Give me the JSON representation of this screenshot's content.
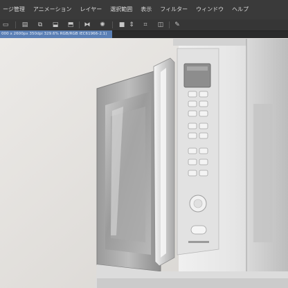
{
  "menubar": {
    "items": [
      "ージ管理",
      "アニメーション",
      "レイヤー",
      "選択範囲",
      "表示",
      "フィルター",
      "ウィンドウ",
      "ヘルプ"
    ]
  },
  "toolbar": {
    "icons": [
      "page-icon",
      "image-icon",
      "layer-icon",
      "save-icon",
      "flip-icon",
      "settings-icon",
      "color-icon",
      "transform-icon",
      "crop-icon",
      "pen-icon"
    ]
  },
  "document": {
    "info": "000 x 2600px 350dpi 329.6%  RGB/RGB IEC61966-2.1)"
  },
  "colors": {
    "menubar_bg": "#3a3a3a",
    "tab_bg": "#5a7fb5",
    "canvas_bg": "#e5e3e0"
  }
}
